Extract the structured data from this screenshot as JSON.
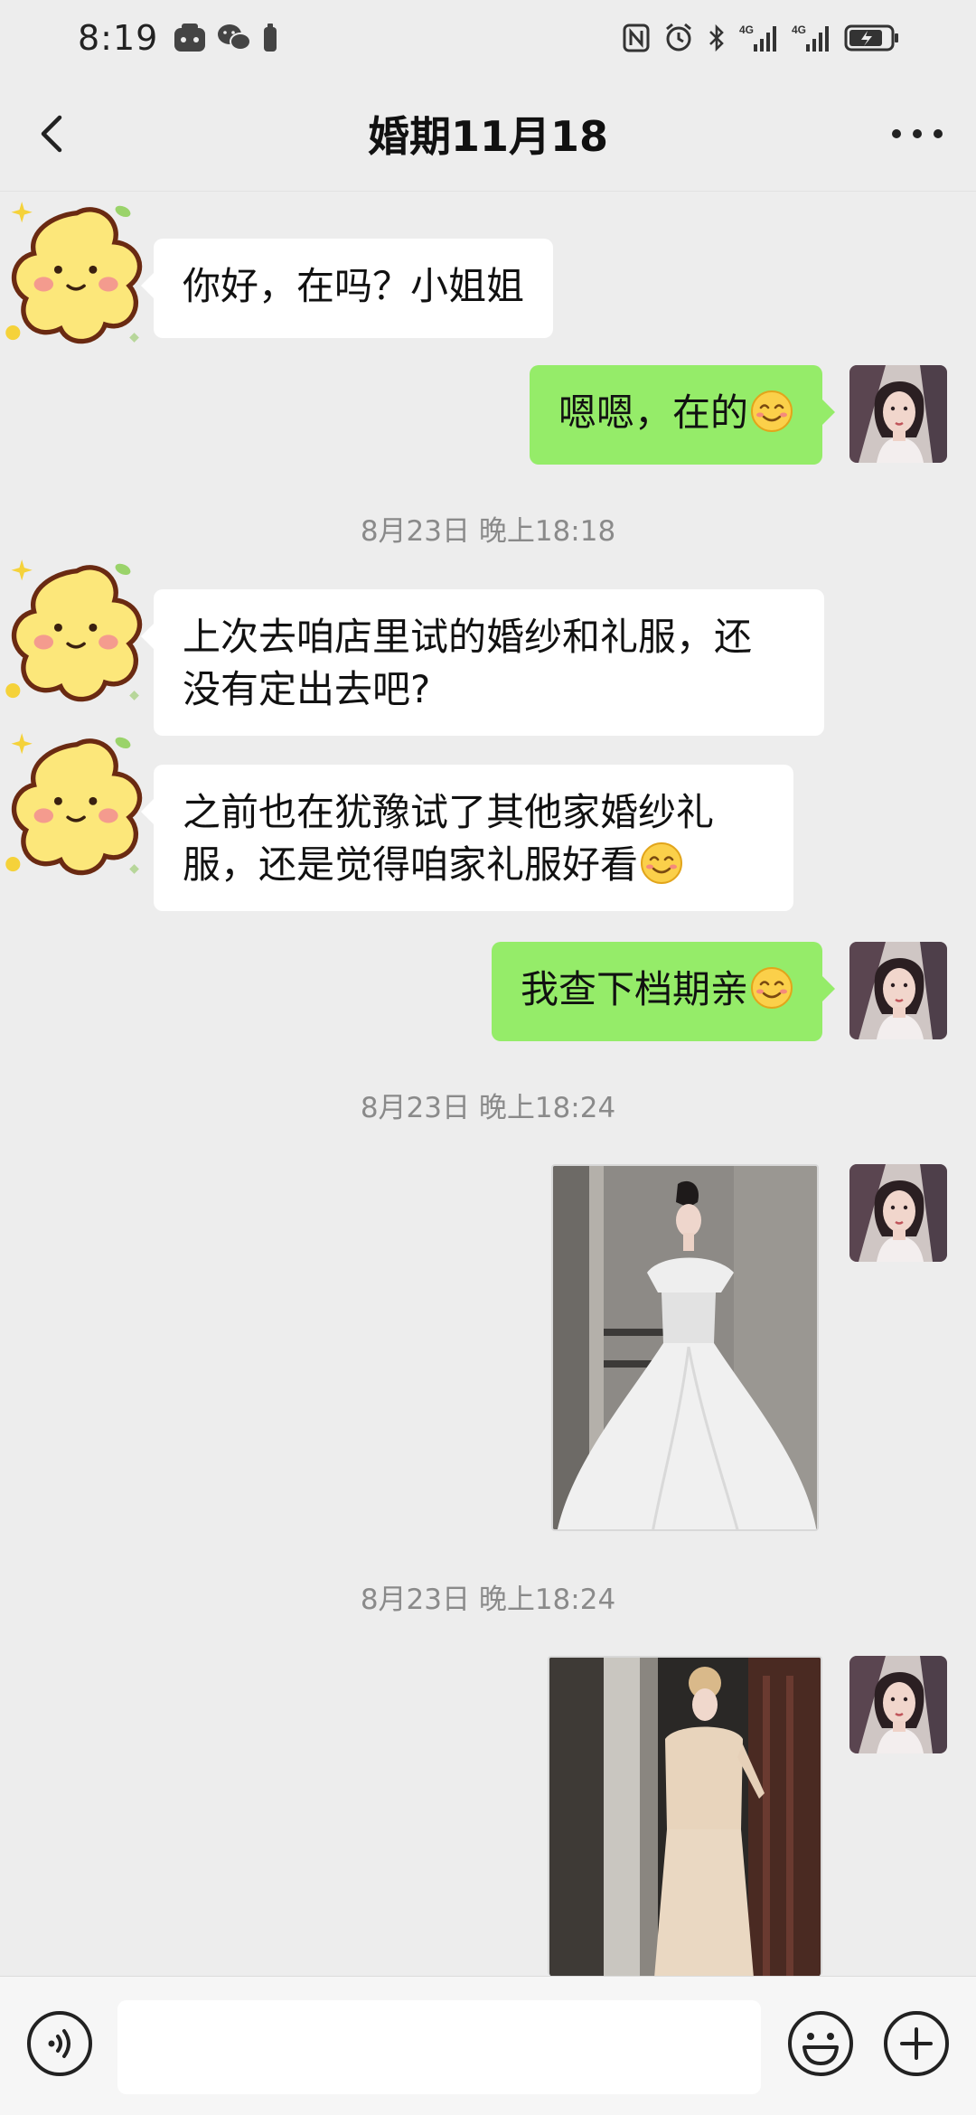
{
  "status_bar": {
    "time": "8:19",
    "icons_left": [
      "app-icon",
      "wechat-icon",
      "battery-saver-icon"
    ],
    "icons_right": [
      "nfc-icon",
      "alarm-icon",
      "bluetooth-icon",
      "signal-4g-icon",
      "signal-4g-icon",
      "battery-charging-icon"
    ],
    "net_label": "4G"
  },
  "header": {
    "title": "婚期11月18",
    "back_icon": "chevron-left-icon",
    "more_icon": "more-dots-icon"
  },
  "messages": [
    {
      "side": "in",
      "text": "你好，在吗？小姐姐"
    },
    {
      "side": "out",
      "text": "嗯嗯，在的",
      "emoji": "smile-emoji"
    },
    {
      "timestamp": "8月23日 晚上18:18"
    },
    {
      "side": "in",
      "lines": [
        "上次去咱店里试的婚纱和礼服，还",
        "没有定出去吧?"
      ]
    },
    {
      "side": "in",
      "lines": [
        "之前也在犹豫试了其他家婚纱礼",
        "服，还是觉得咱家礼服好看"
      ],
      "emoji": "smile-emoji"
    },
    {
      "side": "out",
      "text": "我查下档期亲",
      "emoji": "smile-emoji"
    },
    {
      "timestamp": "8月23日 晚上18:24"
    },
    {
      "side": "out",
      "image": "white-wedding-gown-photo"
    },
    {
      "timestamp": "8月23日 晚上18:24"
    },
    {
      "side": "out",
      "image": "chinese-wedding-dress-photo"
    }
  ],
  "input_bar": {
    "voice_icon": "voice-icon",
    "input_value": "",
    "emoji_icon": "emoji-icon",
    "plus_icon": "plus-icon"
  },
  "colors": {
    "background": "#ededed",
    "outgoing_bubble": "#95ec69",
    "incoming_bubble": "#ffffff",
    "timestamp": "#8a8a8a"
  }
}
